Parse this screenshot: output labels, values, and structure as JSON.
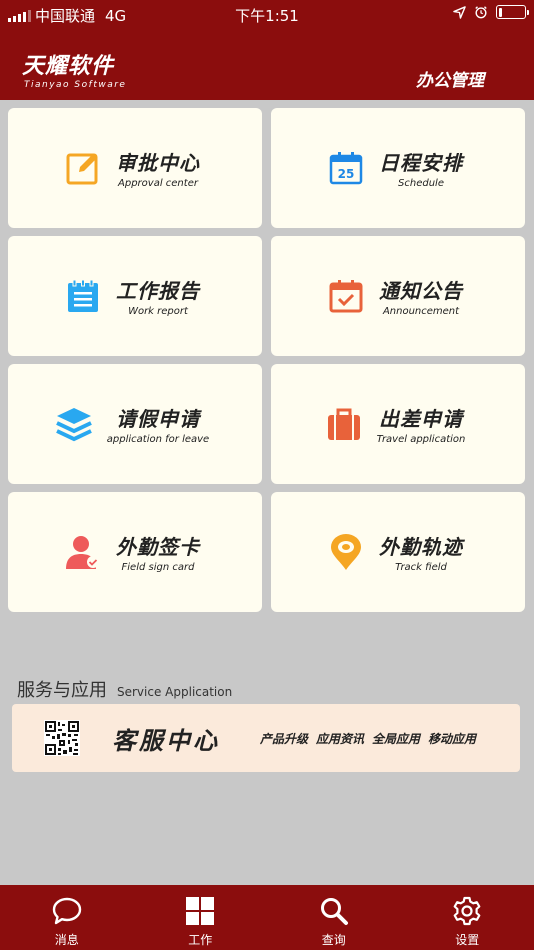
{
  "status_bar": {
    "carrier": "中国联通",
    "network": "4G",
    "time": "下午1:51",
    "battery_level": 0.15
  },
  "header": {
    "brand_cn": "天耀软件",
    "brand_en": "Tianyao Software",
    "module_title": "办公管理"
  },
  "grid": [
    {
      "title": "审批中心",
      "subtitle": "Approval center",
      "icon": "edit-icon",
      "color": "#f5a623"
    },
    {
      "title": "日程安排",
      "subtitle": "Schedule",
      "icon": "calendar-icon",
      "icon_text": "25",
      "color": "#1e88e5"
    },
    {
      "title": "工作报告",
      "subtitle": "Work report",
      "icon": "notepad-icon",
      "color": "#29a8f0"
    },
    {
      "title": "通知公告",
      "subtitle": "Announcement",
      "icon": "calendar-check-icon",
      "color": "#e8623a"
    },
    {
      "title": "请假申请",
      "subtitle": "application for leave",
      "icon": "layers-icon",
      "color": "#29a8f0"
    },
    {
      "title": "出差申请",
      "subtitle": "Travel application",
      "icon": "suitcase-icon",
      "color": "#e8623a"
    },
    {
      "title": "外勤签卡",
      "subtitle": "Field sign card",
      "icon": "user-check-icon",
      "color": "#ee5a5a"
    },
    {
      "title": "外勤轨迹",
      "subtitle": "Track field",
      "icon": "location-pin-icon",
      "color": "#f5a623"
    }
  ],
  "services": {
    "label_cn": "服务与应用",
    "label_en": "Service Application",
    "center_title": "客服中心",
    "links": [
      "产品升级",
      "应用资讯",
      "全局应用",
      "移动应用"
    ]
  },
  "tabbar": [
    {
      "label": "消息",
      "icon": "chat-bubble-icon"
    },
    {
      "label": "工作",
      "icon": "grid-icon"
    },
    {
      "label": "查询",
      "icon": "search-icon"
    },
    {
      "label": "设置",
      "icon": "gear-icon"
    }
  ],
  "colors": {
    "brand": "#8b0d0d",
    "background": "#c8c8c8",
    "card": "#fffdf0",
    "service_card": "#fbeadb"
  }
}
